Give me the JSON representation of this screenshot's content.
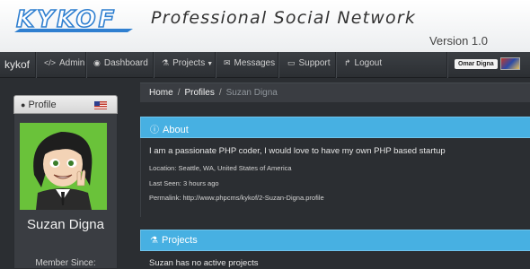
{
  "banner": {
    "logo_text": "KYKOF",
    "tagline": "Professional Social Network",
    "version": "Version 1.0"
  },
  "navbar": {
    "brand": "kykof",
    "items": [
      {
        "label": "Admin",
        "icon": "code-icon"
      },
      {
        "label": "Dashboard",
        "icon": "dashboard-icon"
      },
      {
        "label": "Projects",
        "icon": "flask-icon",
        "dropdown": true
      },
      {
        "label": "Messages",
        "icon": "envelope-icon"
      },
      {
        "label": "Support",
        "icon": "monitor-icon"
      },
      {
        "label": "Logout",
        "icon": "share-icon"
      }
    ],
    "user_name": "Omar Digna"
  },
  "profile": {
    "header": "Profile",
    "name": "Suzan Digna",
    "member_since_label": "Member Since:"
  },
  "breadcrumb": {
    "home": "Home",
    "profiles": "Profiles",
    "current": "Suzan Digna",
    "separator": "/"
  },
  "about": {
    "title": "About",
    "bio": "I am a passionate PHP coder, I would love to have my own PHP based startup",
    "location": "Location: Seattle, WA, United States of America",
    "last_seen": "Last Seen: 3 hours ago",
    "permalink": "Permalink: http://www.phpcms/kykof/2-Suzan-Digna.profile"
  },
  "projects": {
    "title": "Projects",
    "empty_text": "Suzan has no active projects"
  },
  "colors": {
    "accent": "#47b0e2",
    "background": "#2b2e32",
    "navbar": "#33373b"
  }
}
